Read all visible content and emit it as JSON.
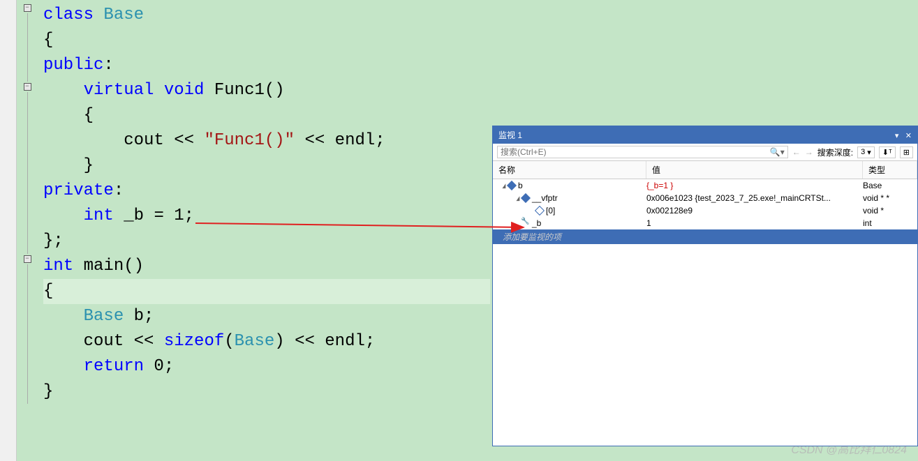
{
  "code": {
    "lines": [
      {
        "tokens": [
          {
            "t": "class ",
            "c": "kw"
          },
          {
            "t": "Base",
            "c": "type"
          }
        ]
      },
      {
        "tokens": [
          {
            "t": "{",
            "c": ""
          }
        ]
      },
      {
        "tokens": [
          {
            "t": "public",
            "c": "kw"
          },
          {
            "t": ":",
            "c": ""
          }
        ]
      },
      {
        "tokens": [
          {
            "t": "    ",
            "c": ""
          },
          {
            "t": "virtual",
            "c": "kw"
          },
          {
            "t": " ",
            "c": ""
          },
          {
            "t": "void",
            "c": "kw"
          },
          {
            "t": " Func1()",
            "c": ""
          }
        ]
      },
      {
        "tokens": [
          {
            "t": "    {",
            "c": ""
          }
        ]
      },
      {
        "tokens": [
          {
            "t": "        cout << ",
            "c": ""
          },
          {
            "t": "\"Func1()\"",
            "c": "str"
          },
          {
            "t": " << endl;",
            "c": ""
          }
        ]
      },
      {
        "tokens": [
          {
            "t": "    }",
            "c": ""
          }
        ]
      },
      {
        "tokens": [
          {
            "t": "private",
            "c": "kw"
          },
          {
            "t": ":",
            "c": ""
          }
        ]
      },
      {
        "tokens": [
          {
            "t": "    ",
            "c": ""
          },
          {
            "t": "int",
            "c": "kw"
          },
          {
            "t": " _b = 1;",
            "c": ""
          }
        ]
      },
      {
        "tokens": [
          {
            "t": "};",
            "c": ""
          }
        ]
      },
      {
        "tokens": [
          {
            "t": "int",
            "c": "kw"
          },
          {
            "t": " main()",
            "c": ""
          }
        ]
      },
      {
        "tokens": [
          {
            "t": "{",
            "c": ""
          }
        ],
        "hl": true
      },
      {
        "tokens": [
          {
            "t": "    ",
            "c": ""
          },
          {
            "t": "Base",
            "c": "type"
          },
          {
            "t": " b;",
            "c": ""
          }
        ]
      },
      {
        "tokens": [
          {
            "t": "    cout << ",
            "c": ""
          },
          {
            "t": "sizeof",
            "c": "kw"
          },
          {
            "t": "(",
            "c": ""
          },
          {
            "t": "Base",
            "c": "type"
          },
          {
            "t": ") << endl;",
            "c": ""
          }
        ]
      },
      {
        "tokens": [
          {
            "t": "",
            "c": ""
          }
        ]
      },
      {
        "tokens": [
          {
            "t": "    ",
            "c": ""
          },
          {
            "t": "return",
            "c": "kw"
          },
          {
            "t": " 0;",
            "c": ""
          }
        ]
      },
      {
        "tokens": [
          {
            "t": "}",
            "c": ""
          }
        ]
      }
    ]
  },
  "watch": {
    "title": "监视 1",
    "search_placeholder": "搜索(Ctrl+E)",
    "depth_label": "搜索深度:",
    "depth_value": "3",
    "headers": {
      "name": "名称",
      "value": "值",
      "type": "类型"
    },
    "rows": [
      {
        "indent": 0,
        "expand": "▲",
        "icon": "cube",
        "name": "b",
        "value": "{_b=1 }",
        "value_cls": "value-red",
        "type": "Base"
      },
      {
        "indent": 1,
        "expand": "▲",
        "icon": "cube",
        "name": "__vfptr",
        "value": "0x006e1023 {test_2023_7_25.exe!_mainCRTSt...",
        "type": "void * *",
        "boxed": true
      },
      {
        "indent": 2,
        "expand": "",
        "icon": "outline",
        "name": "[0]",
        "value": "0x002128e9",
        "type": "void *"
      },
      {
        "indent": 1,
        "expand": "",
        "icon": "wrench",
        "name": "_b",
        "value": "1",
        "type": "int",
        "boxed": true
      }
    ],
    "add_text": "添加要监视的项"
  },
  "watermark": "CSDN @高比拜仁0824"
}
